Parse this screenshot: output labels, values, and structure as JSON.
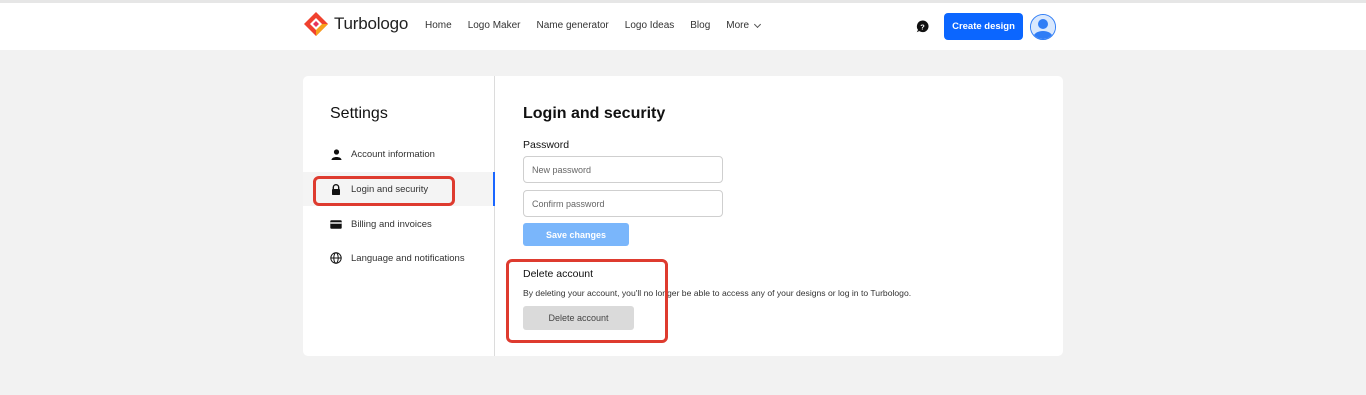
{
  "header": {
    "brand": "Turbologo",
    "nav": [
      "Home",
      "Logo Maker",
      "Name generator",
      "Logo Ideas",
      "Blog"
    ],
    "more_label": "More",
    "create_label": "Create design",
    "icons": {
      "help": "chat-help-icon",
      "avatar": "user-avatar-icon",
      "more": "chevron-down-icon"
    },
    "colors": {
      "primary": "#0b66ff"
    }
  },
  "sidebar": {
    "title": "Settings",
    "items": [
      {
        "label": "Account information",
        "icon": "person-icon",
        "active": false
      },
      {
        "label": "Login and security",
        "icon": "lock-icon",
        "active": true
      },
      {
        "label": "Billing and invoices",
        "icon": "credit-card-icon",
        "active": false
      },
      {
        "label": "Language and notifications",
        "icon": "globe-icon",
        "active": false
      }
    ]
  },
  "main": {
    "title": "Login and security",
    "password_label": "Password",
    "new_password_placeholder": "New password",
    "confirm_password_placeholder": "Confirm password",
    "save_label": "Save changes",
    "delete": {
      "title": "Delete account",
      "description": "By deleting your account, you'll no longer be able to access any of your designs or log in to Turbologo.",
      "button": "Delete account"
    }
  },
  "annotations": {
    "highlight_color": "#de3b2f"
  }
}
